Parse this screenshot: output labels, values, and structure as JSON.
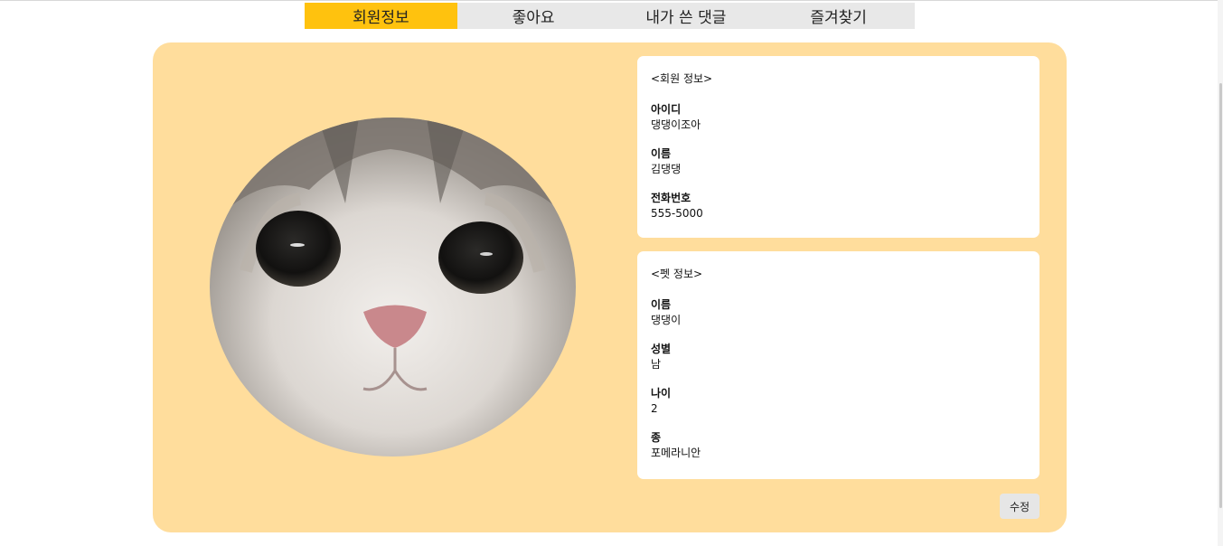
{
  "tabs": [
    {
      "label": "회원정보",
      "active": true
    },
    {
      "label": "좋아요",
      "active": false
    },
    {
      "label": "내가 쓴 댓글",
      "active": false
    },
    {
      "label": "즐겨찾기",
      "active": false
    }
  ],
  "colors": {
    "active_tab": "#ffc20e",
    "tab": "#e8e8e8",
    "panel": "#ffdd9c",
    "card": "#ffffff"
  },
  "profile": {
    "image": "cat-photo"
  },
  "user_info": {
    "heading": "<회원 정보>",
    "fields": [
      {
        "label": "아이디",
        "value": "댕댕이조아"
      },
      {
        "label": "이름",
        "value": "김댕댕"
      },
      {
        "label": "전화번호",
        "value": "555-5000"
      }
    ]
  },
  "pet_info": {
    "heading": "<펫 정보>",
    "fields": [
      {
        "label": "이름",
        "value": "댕댕이"
      },
      {
        "label": "성별",
        "value": "남"
      },
      {
        "label": "나이",
        "value": "2"
      },
      {
        "label": "종",
        "value": "포메라니안"
      }
    ]
  },
  "edit_label": "수정"
}
